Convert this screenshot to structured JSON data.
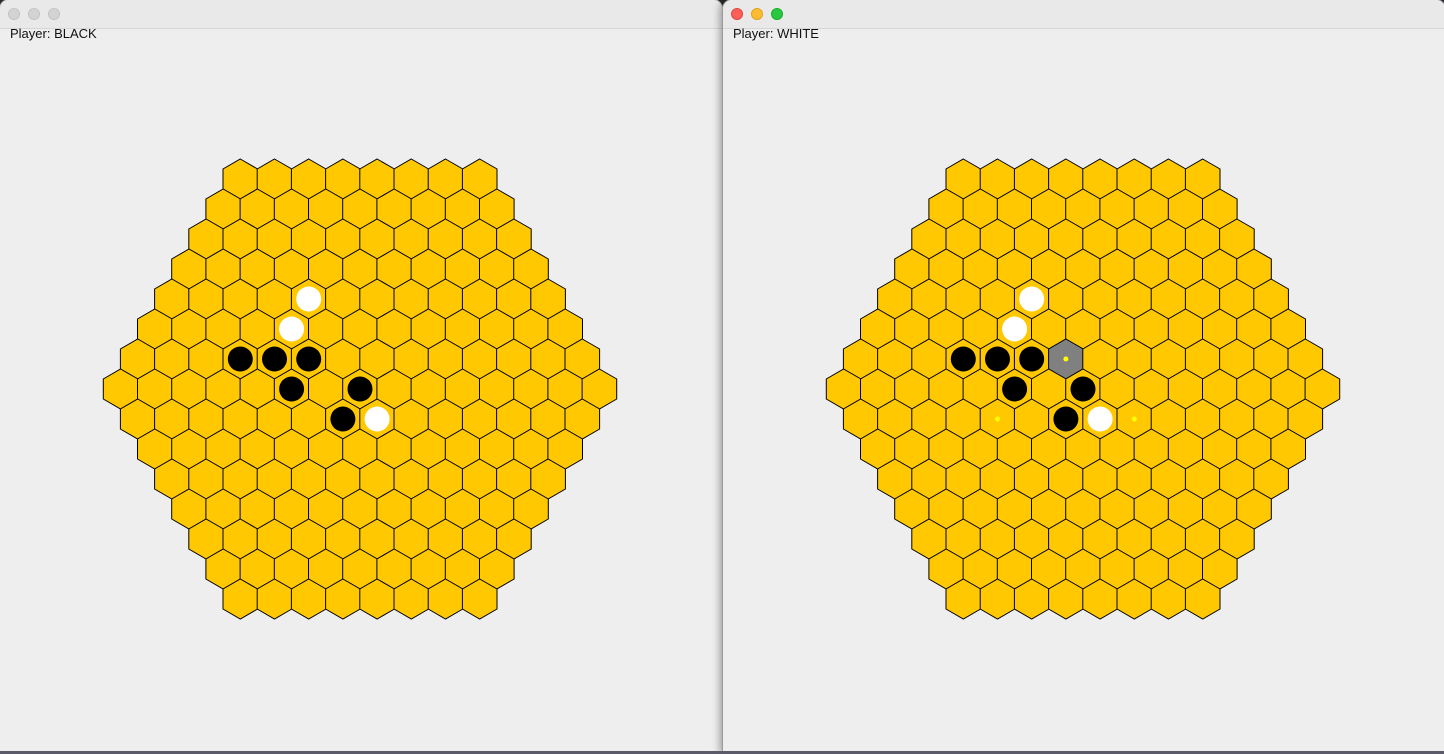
{
  "colors": {
    "cell": "#ffc800",
    "cell_stroke": "#000000",
    "selected_cell": "#808080",
    "black_stone": "#000000",
    "white_stone": "#ffffff",
    "legal_move_dot": "#ffff00",
    "window_bg": "#eeeeee"
  },
  "board": {
    "radius": 7
  },
  "windows": [
    {
      "id": "left",
      "active": false,
      "player_label": "Player: BLACK",
      "stones": [
        {
          "color": "white",
          "q": 0,
          "r": -3
        },
        {
          "color": "white",
          "q": -1,
          "r": -2
        },
        {
          "color": "black",
          "q": -3,
          "r": -1
        },
        {
          "color": "black",
          "q": -2,
          "r": -1
        },
        {
          "color": "black",
          "q": -1,
          "r": -1
        },
        {
          "color": "black",
          "q": -2,
          "r": 0
        },
        {
          "color": "black",
          "q": 0,
          "r": 0
        },
        {
          "color": "black",
          "q": -1,
          "r": 1
        },
        {
          "color": "white",
          "q": 0,
          "r": 1
        }
      ],
      "selected": [],
      "hints": []
    },
    {
      "id": "right",
      "active": true,
      "player_label": "Player: WHITE",
      "stones": [
        {
          "color": "white",
          "q": 0,
          "r": -3
        },
        {
          "color": "white",
          "q": -1,
          "r": -2
        },
        {
          "color": "black",
          "q": -3,
          "r": -1
        },
        {
          "color": "black",
          "q": -2,
          "r": -1
        },
        {
          "color": "black",
          "q": -1,
          "r": -1
        },
        {
          "color": "black",
          "q": -2,
          "r": 0
        },
        {
          "color": "black",
          "q": 0,
          "r": 0
        },
        {
          "color": "black",
          "q": -1,
          "r": 1
        },
        {
          "color": "white",
          "q": 0,
          "r": 1
        }
      ],
      "selected": [
        {
          "q": 0,
          "r": -1
        }
      ],
      "hints": [
        {
          "q": 0,
          "r": -1
        },
        {
          "q": -3,
          "r": 1
        },
        {
          "q": 1,
          "r": 1
        }
      ]
    }
  ]
}
